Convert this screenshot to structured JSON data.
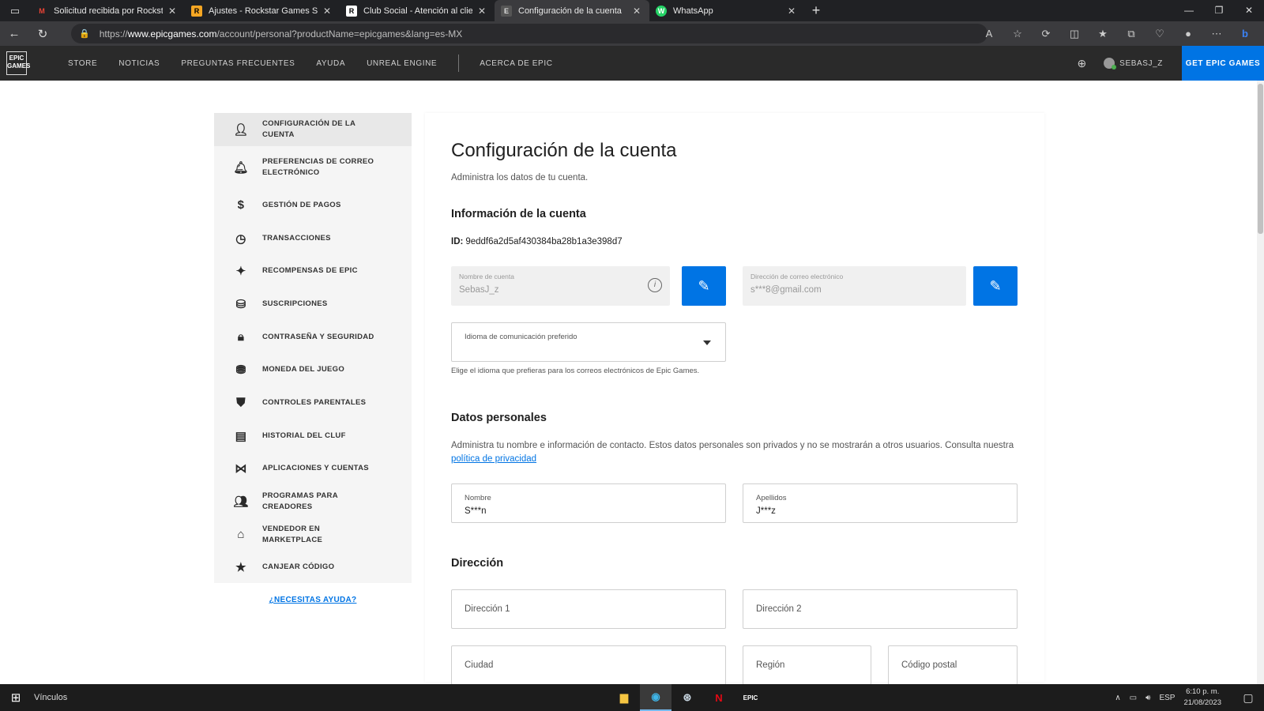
{
  "browser": {
    "tabs": [
      {
        "label": "Solicitud recibida por Rockstar G",
        "icon": "M",
        "icon_color": "#ea4335"
      },
      {
        "label": "Ajustes - Rockstar Games Social",
        "icon": "R",
        "icon_color": "#f5a623"
      },
      {
        "label": "Club Social - Atención al cliente",
        "icon": "R",
        "icon_color": "#ffffff"
      },
      {
        "label": "Configuración de la cuenta",
        "icon": "E",
        "icon_color": "#cccccc",
        "active": true
      },
      {
        "label": "WhatsApp",
        "icon": "W",
        "icon_color": "#25d366"
      }
    ],
    "url_prefix": "https://",
    "url_domain": "www.epicgames.com",
    "url_path": "/account/personal?productName=epicgames&lang=es-MX"
  },
  "epic_nav": {
    "logo": "EPIC GAMES",
    "items": [
      "STORE",
      "NOTICIAS",
      "PREGUNTAS FRECUENTES",
      "AYUDA",
      "UNREAL ENGINE"
    ],
    "about": "ACERCA DE EPIC",
    "username": "SEBASJ_Z",
    "get_button": "GET EPIC GAMES"
  },
  "sidebar": {
    "items": [
      {
        "label": "CONFIGURACIÓN DE LA CUENTA",
        "icon": "person-icon",
        "active": true
      },
      {
        "label": "PREFERENCIAS DE CORREO ELECTRÓNICO",
        "icon": "bell-icon"
      },
      {
        "label": "GESTIÓN DE PAGOS",
        "icon": "dollar-icon"
      },
      {
        "label": "TRANSACCIONES",
        "icon": "clock-icon"
      },
      {
        "label": "RECOMPENSAS DE EPIC",
        "icon": "rewards-icon"
      },
      {
        "label": "SUSCRIPCIONES",
        "icon": "subscriptions-icon"
      },
      {
        "label": "CONTRASEÑA Y SEGURIDAD",
        "icon": "lock-icon"
      },
      {
        "label": "MONEDA DEL JUEGO",
        "icon": "currency-icon"
      },
      {
        "label": "CONTROLES PARENTALES",
        "icon": "shield-icon"
      },
      {
        "label": "HISTORIAL DEL CLUF",
        "icon": "document-icon"
      },
      {
        "label": "APLICACIONES Y CUENTAS",
        "icon": "apps-icon"
      },
      {
        "label": "PROGRAMAS PARA CREADORES",
        "icon": "people-icon"
      },
      {
        "label": "VENDEDOR EN MARKETPLACE",
        "icon": "store-icon"
      },
      {
        "label": "CANJEAR CÓDIGO",
        "icon": "star-icon"
      }
    ],
    "help": "¿NECESITAS AYUDA?"
  },
  "main": {
    "title": "Configuración de la cuenta",
    "subtitle": "Administra los datos de tu cuenta.",
    "account_section": "Información de la cuenta",
    "id_label": "ID:",
    "id_value": "9eddf6a2d5af430384ba28b1a3e398d7",
    "account_name_label": "Nombre de cuenta",
    "account_name_value": "SebasJ_z",
    "email_label": "Dirección de correo electrónico",
    "email_value": "s***8@gmail.com",
    "language_label": "Idioma de comunicación preferido",
    "language_hint": "Elige el idioma que prefieras para los correos electrónicos de Epic Games.",
    "personal_section": "Datos personales",
    "personal_text": "Administra tu nombre e información de contacto. Estos datos personales son privados y no se mostrarán a otros usuarios. Consulta nuestra",
    "privacy_link": "política de privacidad",
    "first_name_label": "Nombre",
    "first_name_value": "S***n",
    "last_name_label": "Apellidos",
    "last_name_value": "J***z",
    "address_section": "Dirección",
    "address1_placeholder": "Dirección 1",
    "address2_placeholder": "Dirección 2",
    "city_placeholder": "Ciudad",
    "region_placeholder": "Región",
    "postal_placeholder": "Código postal"
  },
  "taskbar": {
    "links": "Vínculos",
    "language": "ESP",
    "time": "6:10 p. m.",
    "date": "21/08/2023"
  }
}
